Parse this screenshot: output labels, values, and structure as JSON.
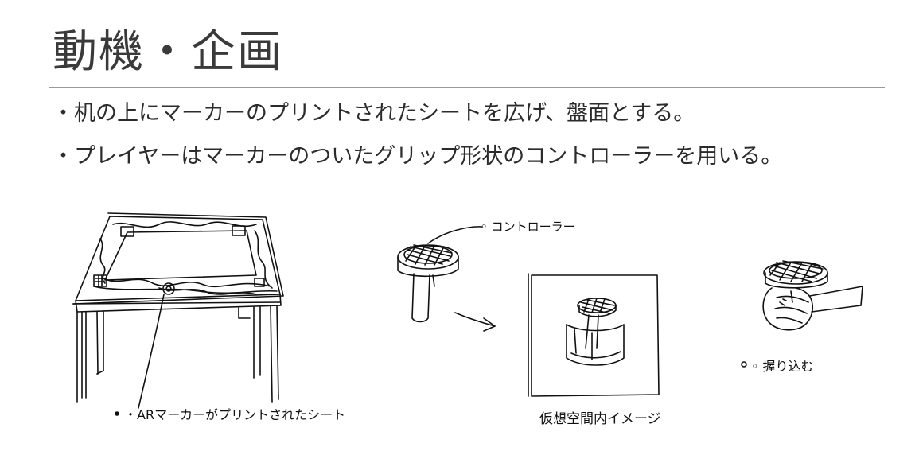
{
  "slide": {
    "title": "動機・企画",
    "bullets": [
      "・机の上にマーカーのプリントされたシートを広げ、盤面とする。",
      "・プレイヤーはマーカーのついたグリップ形状のコントローラーを用いる。"
    ]
  },
  "sketch": {
    "labels": {
      "sheet": "・ARマーカーがプリントされたシート",
      "controller": "◦ コントローラー",
      "virtual_space": "仮想空間内イメージ",
      "grip": "◦ 握り込む"
    }
  }
}
